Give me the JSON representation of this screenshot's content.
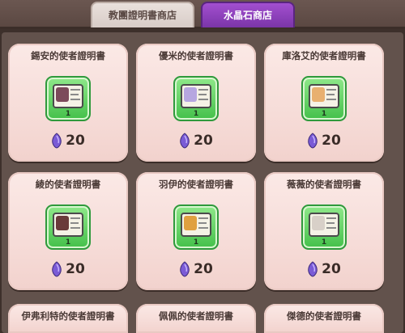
{
  "tabs": [
    {
      "label": "教團證明書商店",
      "active": false
    },
    {
      "label": "水晶石商店",
      "active": true
    }
  ],
  "currency": {
    "icon": "crystal-icon",
    "color": "#7a5bd6"
  },
  "items": [
    {
      "title": "錫安的使者證明書",
      "count": "1",
      "price": "20",
      "portrait_color": "#7c4a5a"
    },
    {
      "title": "優米的使者證明書",
      "count": "1",
      "price": "20",
      "portrait_color": "#b6a6e0"
    },
    {
      "title": "庫洛艾的使者證明書",
      "count": "1",
      "price": "20",
      "portrait_color": "#e8b070"
    },
    {
      "title": "綾的使者證明書",
      "count": "1",
      "price": "20",
      "portrait_color": "#6a3a3a"
    },
    {
      "title": "羽伊的使者證明書",
      "count": "1",
      "price": "20",
      "portrait_color": "#e0a040"
    },
    {
      "title": "薇薇的使者證明書",
      "count": "1",
      "price": "20",
      "portrait_color": "#d8d0c8"
    },
    {
      "title": "伊弗利特的使者證明書",
      "count": "",
      "price": "",
      "portrait_color": ""
    },
    {
      "title": "佩佩的使者證明書",
      "count": "",
      "price": "",
      "portrait_color": ""
    },
    {
      "title": "傑德的使者證明書",
      "count": "",
      "price": "",
      "portrait_color": ""
    }
  ]
}
